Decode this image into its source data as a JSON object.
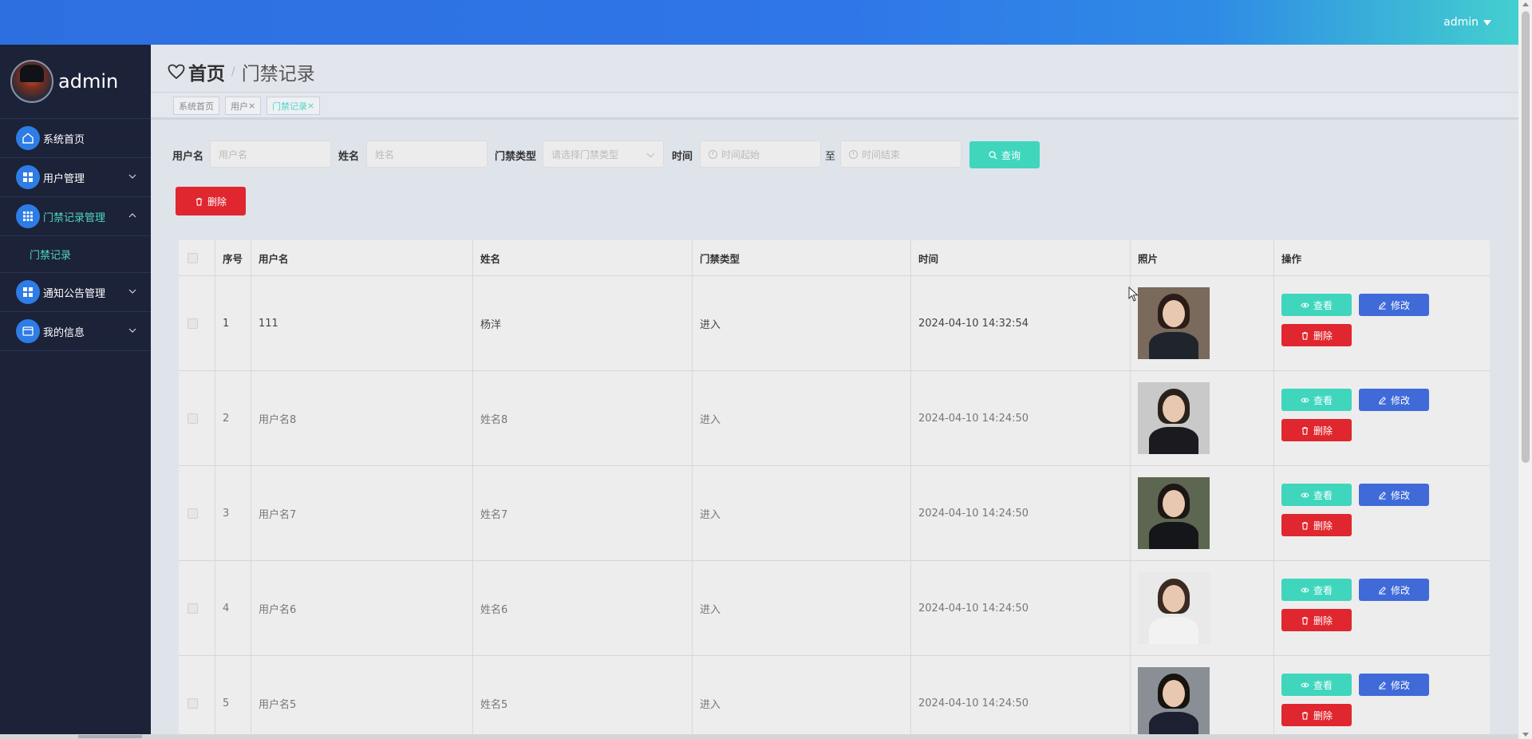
{
  "topbar": {
    "user": "admin"
  },
  "sidebar": {
    "brand": "admin",
    "items": [
      {
        "label": "系统首页",
        "icon": "home-icon",
        "expandable": false
      },
      {
        "label": "用户管理",
        "icon": "grid-icon",
        "expandable": true,
        "expanded": false
      },
      {
        "label": "门禁记录管理",
        "icon": "apps-icon",
        "expandable": true,
        "expanded": true,
        "children": [
          "门禁记录"
        ]
      },
      {
        "label": "通知公告管理",
        "icon": "grid-icon",
        "expandable": true,
        "expanded": false
      },
      {
        "label": "我的信息",
        "icon": "card-icon",
        "expandable": true,
        "expanded": false
      }
    ]
  },
  "breadcrumb": {
    "home": "首页",
    "separator": "/",
    "current": "门禁记录"
  },
  "tags": [
    {
      "label": "系统首页",
      "closable": false
    },
    {
      "label": "用户",
      "closable": true
    },
    {
      "label": "门禁记录",
      "closable": true,
      "active": true
    }
  ],
  "search": {
    "username_label": "用户名",
    "username_placeholder": "用户名",
    "name_label": "姓名",
    "name_placeholder": "姓名",
    "type_label": "门禁类型",
    "type_placeholder": "请选择门禁类型",
    "time_label": "时间",
    "time_start_placeholder": "时间起始",
    "time_to": "至",
    "time_end_placeholder": "时间结束",
    "query_button": "查询"
  },
  "toolbar": {
    "delete_button": "删除"
  },
  "table": {
    "columns": [
      "序号",
      "用户名",
      "姓名",
      "门禁类型",
      "时间",
      "照片",
      "操作"
    ],
    "rows": [
      {
        "index": "1",
        "username": "111",
        "name": "杨洋",
        "type": "进入",
        "time": "2024-04-10 14:32:54"
      },
      {
        "index": "2",
        "username": "用户名8",
        "name": "姓名8",
        "type": "进入",
        "time": "2024-04-10 14:24:50"
      },
      {
        "index": "3",
        "username": "用户名7",
        "name": "姓名7",
        "type": "进入",
        "time": "2024-04-10 14:24:50"
      },
      {
        "index": "4",
        "username": "用户名6",
        "name": "姓名6",
        "type": "进入",
        "time": "2024-04-10 14:24:50"
      },
      {
        "index": "5",
        "username": "用户名5",
        "name": "姓名5",
        "type": "进入",
        "time": "2024-04-10 14:24:50"
      }
    ],
    "actions": {
      "view": "查看",
      "edit": "修改",
      "delete": "删除"
    }
  },
  "colors": {
    "accent": "#3fd6bd",
    "primary": "#3f6ad8",
    "danger": "#e0262e",
    "sidebar": "#1c2238"
  }
}
